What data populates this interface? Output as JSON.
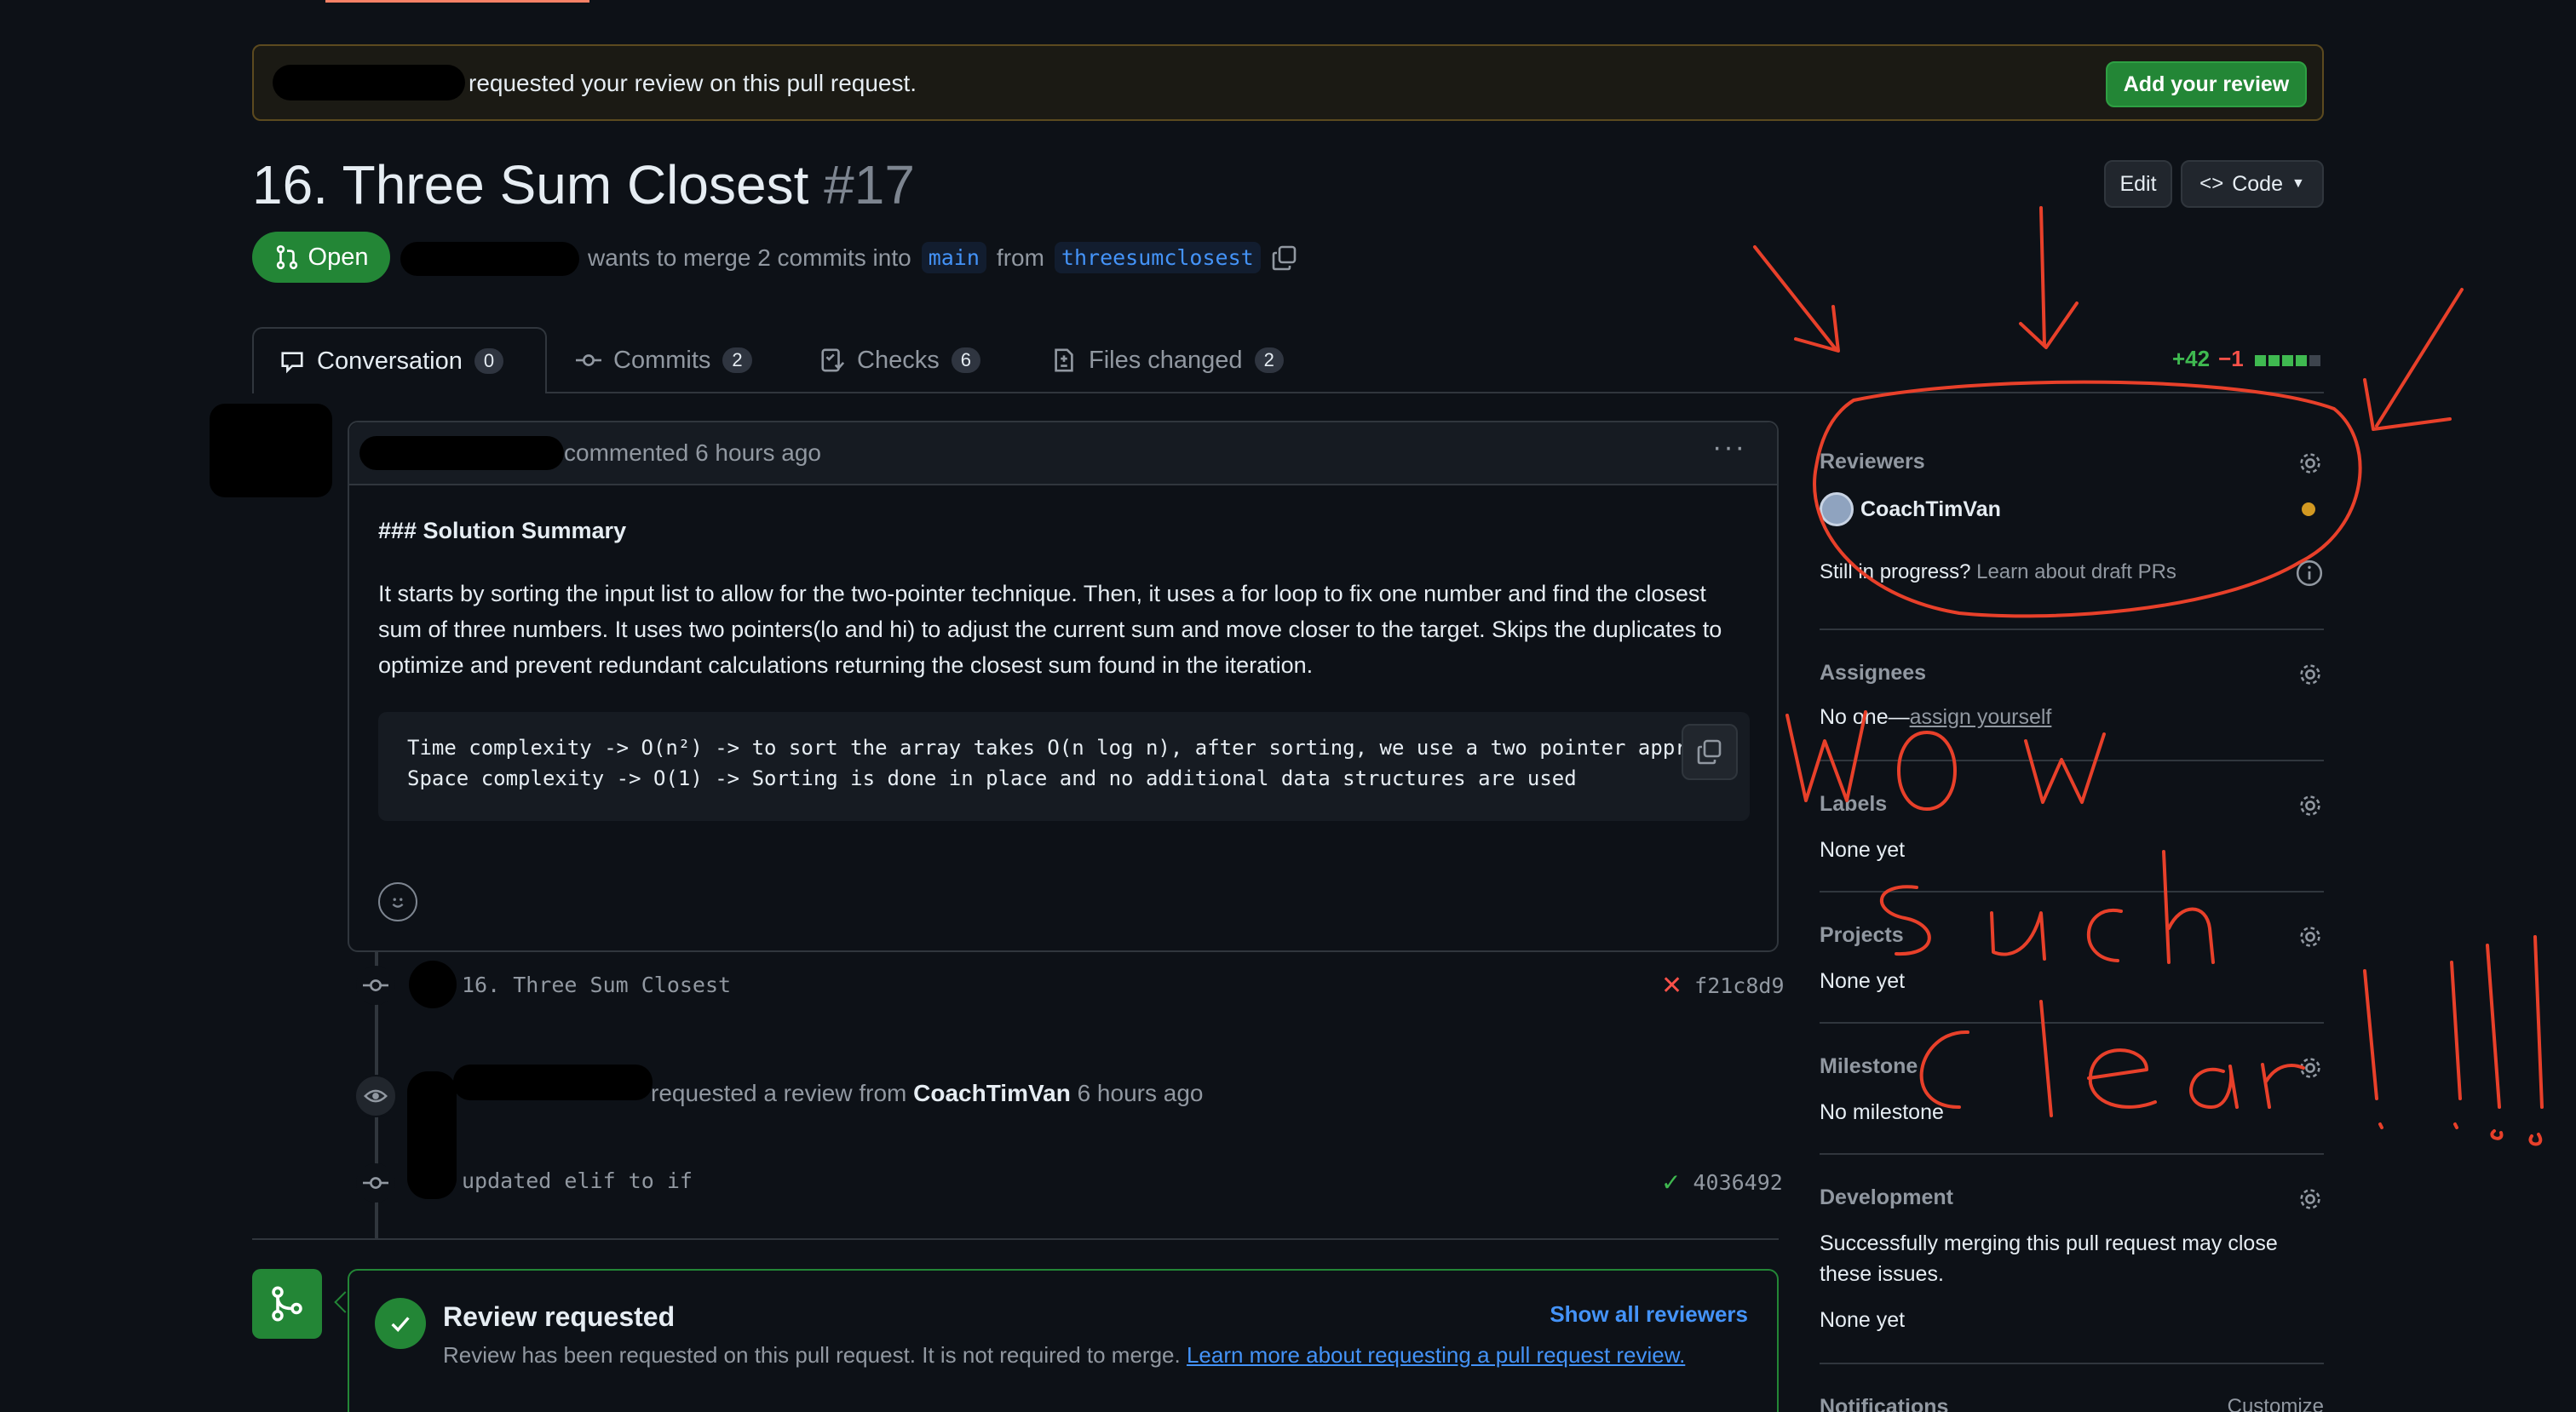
{
  "banner": {
    "text": "requested your review on this pull request.",
    "button": "Add your review"
  },
  "pr": {
    "title": "16. Three Sum Closest",
    "number": "#17",
    "state": "Open",
    "merge_text": "wants to merge 2 commits into",
    "base": "main",
    "from_word": "from",
    "head": "threesumclosest"
  },
  "header_buttons": {
    "edit": "Edit",
    "code": "Code"
  },
  "tabs": [
    {
      "label": "Conversation",
      "count": "0"
    },
    {
      "label": "Commits",
      "count": "2"
    },
    {
      "label": "Checks",
      "count": "6"
    },
    {
      "label": "Files changed",
      "count": "2"
    }
  ],
  "diffstat": {
    "additions": "+42",
    "deletions": "−1"
  },
  "comment": {
    "meta": "commented 6 hours ago",
    "heading": "### Solution Summary",
    "paragraph": "It starts by sorting the input list to allow for the two-pointer technique. Then, it uses a for loop to fix one number and find the closest sum of three numbers. It uses two pointers(lo and hi) to adjust the current sum and move closer to the target. Skips the duplicates to optimize and prevent redundant calculations returning the closest sum found in the iteration.",
    "code_line1": "Time complexity -> O(n²) -> to sort the array takes O(n log n), after sorting, we use a two pointer appr",
    "code_line2": "Space complexity -> O(1) -> Sorting is done in place and no additional data structures are used"
  },
  "timeline": {
    "commit1": {
      "message": "16. Three Sum Closest",
      "sha": "f21c8d9"
    },
    "event": {
      "prefix": "requested a review from",
      "user": "CoachTimVan",
      "time": "6 hours ago"
    },
    "commit2": {
      "message": "updated elif to if",
      "sha": "4036492"
    }
  },
  "review": {
    "title": "Review requested",
    "desc": "Review has been requested on this pull request. It is not required to merge.",
    "link": "Learn more about requesting a pull request review.",
    "show_all": "Show all reviewers"
  },
  "sidebar": {
    "reviewers": {
      "title": "Reviewers",
      "name": "CoachTimVan",
      "draft_q": "Still in progress?",
      "draft_link": "Learn about draft PRs"
    },
    "assignees": {
      "title": "Assignees",
      "none": "No one—",
      "assign": "assign yourself"
    },
    "labels": {
      "title": "Labels",
      "value": "None yet"
    },
    "projects": {
      "title": "Projects",
      "value": "None yet"
    },
    "milestone": {
      "title": "Milestone",
      "value": "No milestone"
    },
    "development": {
      "title": "Development",
      "desc": "Successfully merging this pull request may close these issues.",
      "value": "None yet"
    },
    "notifications": {
      "title": "Notifications",
      "customize": "Customize"
    }
  },
  "colors": {
    "accent_green": "#238636",
    "link_blue": "#4493f8",
    "annotation_red": "#e8402a",
    "pending_dot": "#d29922"
  }
}
